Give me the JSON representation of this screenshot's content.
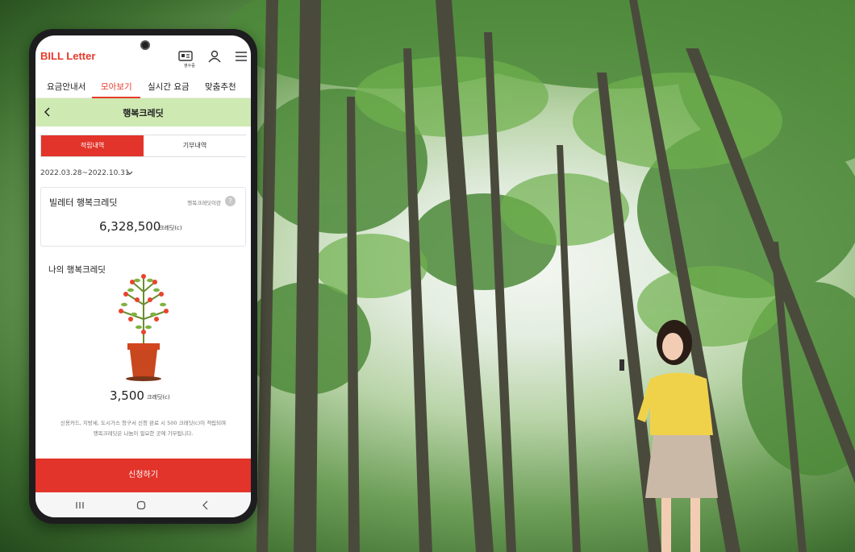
{
  "app": {
    "logo_bill": "BILL",
    "logo_letter": "Letter",
    "receipt_label": "영수증",
    "icons": [
      "receipt-icon",
      "person-icon",
      "menu-icon"
    ]
  },
  "tabs": [
    {
      "label": "요금안내서",
      "active": false
    },
    {
      "label": "모아보기",
      "active": true
    },
    {
      "label": "실시간 요금",
      "active": false
    },
    {
      "label": "맞춤추천",
      "active": false
    }
  ],
  "subheader": {
    "title": "행복크레딧"
  },
  "segment": {
    "on_label": "적립내역",
    "off_label": "기부내역"
  },
  "period": "2022.03.28~2022.10.31",
  "card": {
    "title": "빌레터 행복크레딧",
    "help_label": "행복크레딧이란",
    "help_icon": "?",
    "value": "6,328,500",
    "unit": "크레딧(c)"
  },
  "my_credit": {
    "title": "나의 행복크레딧",
    "value": "3,500",
    "unit": "크레딧(c)"
  },
  "notice": {
    "line1": "신용카드, 지방세, 도시가스 청구서 신청 완료 시 500 크레딧(c)이 적립되며",
    "line2": "행복크레딧은 나눔이 필요한 곳에 기부됩니다."
  },
  "apply_button": "신청하기",
  "colors": {
    "brand_red": "#e2342a",
    "subheader_green": "#cfe9b2"
  }
}
